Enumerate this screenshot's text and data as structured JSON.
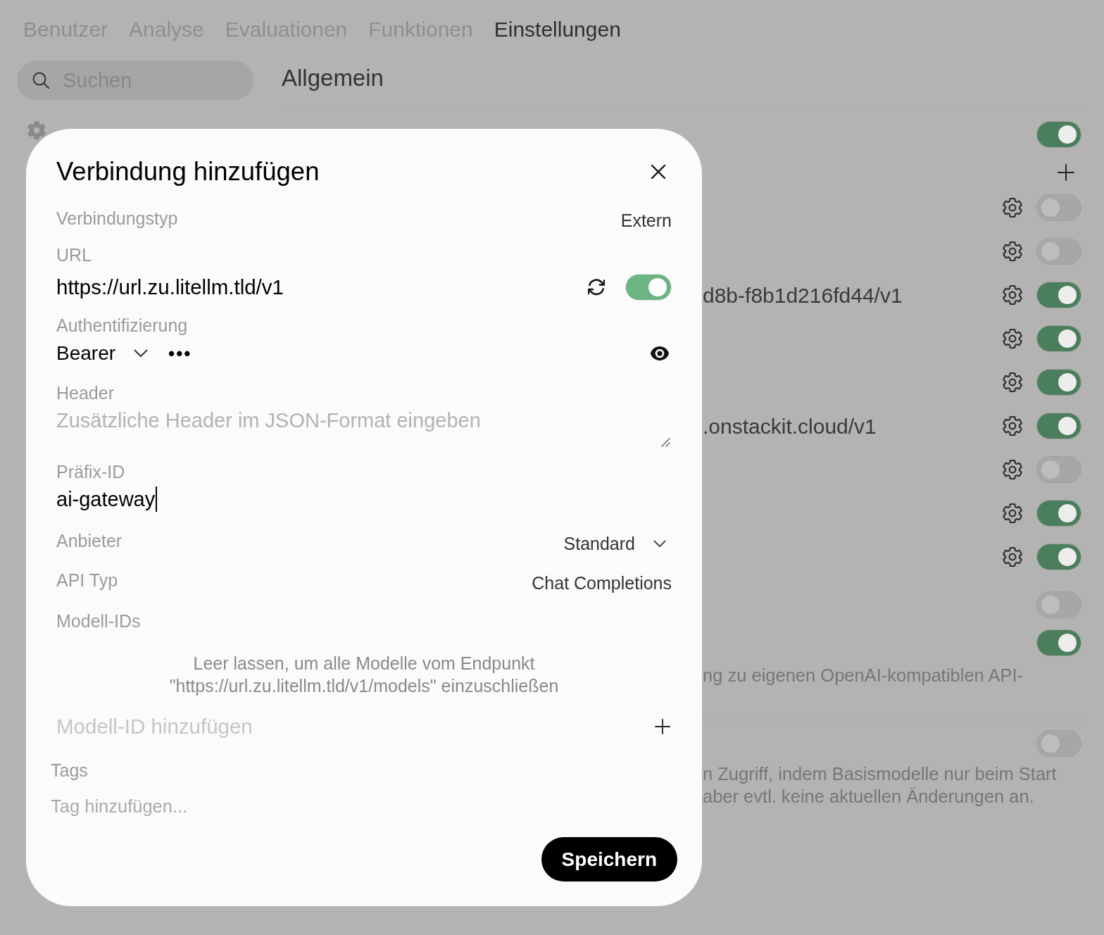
{
  "nav": {
    "tabs": [
      {
        "label": "Benutzer",
        "selected": false
      },
      {
        "label": "Analyse",
        "selected": false
      },
      {
        "label": "Evaluationen",
        "selected": false
      },
      {
        "label": "Funktionen",
        "selected": false
      },
      {
        "label": "Einstellungen",
        "selected": true
      }
    ]
  },
  "sidebar": {
    "search": {
      "placeholder": "Suchen"
    }
  },
  "main": {
    "title": "Allgemein",
    "connections": {
      "on": true,
      "items": [
        {
          "on": false
        },
        {
          "on": false
        },
        {
          "url": "d8b-f8b1d216fd44/v1",
          "on": true
        },
        {
          "on": true
        },
        {
          "on": true
        },
        {
          "url": ".onstackit.cloud/v1",
          "on": true
        },
        {
          "on": false
        },
        {
          "on": true
        },
        {
          "on": true
        }
      ]
    },
    "switches": [
      {
        "on": false
      },
      {
        "on": true
      }
    ],
    "note": "ng zu eigenen OpenAI-kompatiblen API-",
    "section_2": {
      "on": false,
      "description": [
        "n Zugriff, indem Basismodelle nur beim Start",
        "aber evtl. keine aktuellen Änderungen an."
      ]
    }
  },
  "dialog": {
    "title": "Verbindung hinzufügen",
    "connection_type": {
      "label": "Verbindungstyp",
      "value": "Extern"
    },
    "url": {
      "label": "URL",
      "value": "https://url.zu.litellm.tld/v1",
      "enabled": true
    },
    "auth": {
      "label": "Authentifizierung",
      "type": "Bearer",
      "key": "•••"
    },
    "headers": {
      "label": "Header",
      "placeholder": "Zusätzliche Header im JSON-Format eingeben"
    },
    "prefix_id": {
      "label": "Präfix-ID",
      "value": "ai-gateway",
      "focused": true
    },
    "provider": {
      "label": "Anbieter",
      "value": "Standard"
    },
    "api_type": {
      "label": "API Typ",
      "value": "Chat Completions"
    },
    "model_ids": {
      "label": "Modell-IDs",
      "hint": "Leer lassen, um alle Modelle vom Endpunkt \"https://url.zu.litellm.tld/v1/models\" einzuschließen",
      "placeholder": "Modell-ID hinzufügen"
    },
    "tags": {
      "label": "Tags",
      "placeholder": "Tag hinzufügen..."
    },
    "save_button": "Speichern"
  }
}
